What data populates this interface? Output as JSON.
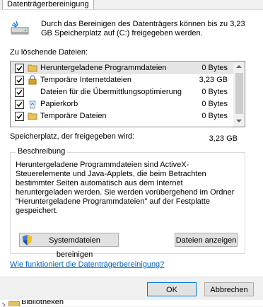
{
  "tab": {
    "label": "Datenträgerbereinigung"
  },
  "intro": {
    "text": "Durch das Bereinigen des Datenträgers können bis zu 3,23 GB Speicherplatz auf  (C:) freigegeben werden."
  },
  "files_label": "Zu löschende Dateien:",
  "files": [
    {
      "name": "Heruntergeladene Programmdateien",
      "size": "0 Bytes",
      "checked": true,
      "icon": "folder-icon",
      "selected": true
    },
    {
      "name": "Temporäre Internetdateien",
      "size": "3,23 GB",
      "checked": true,
      "icon": "lock-icon",
      "selected": false
    },
    {
      "name": "Dateien für die Übermittlungsoptimierung",
      "size": "0 Bytes",
      "checked": true,
      "icon": "blank-icon",
      "selected": false
    },
    {
      "name": "Papierkorb",
      "size": "0 Bytes",
      "checked": true,
      "icon": "recycle-bin-icon",
      "selected": false
    },
    {
      "name": "Temporäre Dateien",
      "size": "0 Bytes",
      "checked": true,
      "icon": "folder-icon",
      "selected": false
    }
  ],
  "space": {
    "label": "Speicherplatz, der freigegeben wird:",
    "value": "3,23 GB"
  },
  "description": {
    "title": "Beschreibung",
    "text": "Heruntergeladene Programmdateien sind ActiveX-Steuerelemente und Java-Applets, die beim Betrachten bestimmter Seiten automatisch aus dem Internet heruntergeladen werden. Sie werden vorübergehend im Ordner \"Heruntergeladene Programmdateien\" auf der Festplatte gespeichert."
  },
  "buttons": {
    "cleanup_system": "Systemdateien bereinigen",
    "view_files": "Dateien anzeigen",
    "ok": "OK",
    "cancel": "Abbrechen"
  },
  "help_link": "Wie funktioniert die Datenträgerbereinigung?",
  "behind_window": {
    "label": "Bibliotheken"
  }
}
